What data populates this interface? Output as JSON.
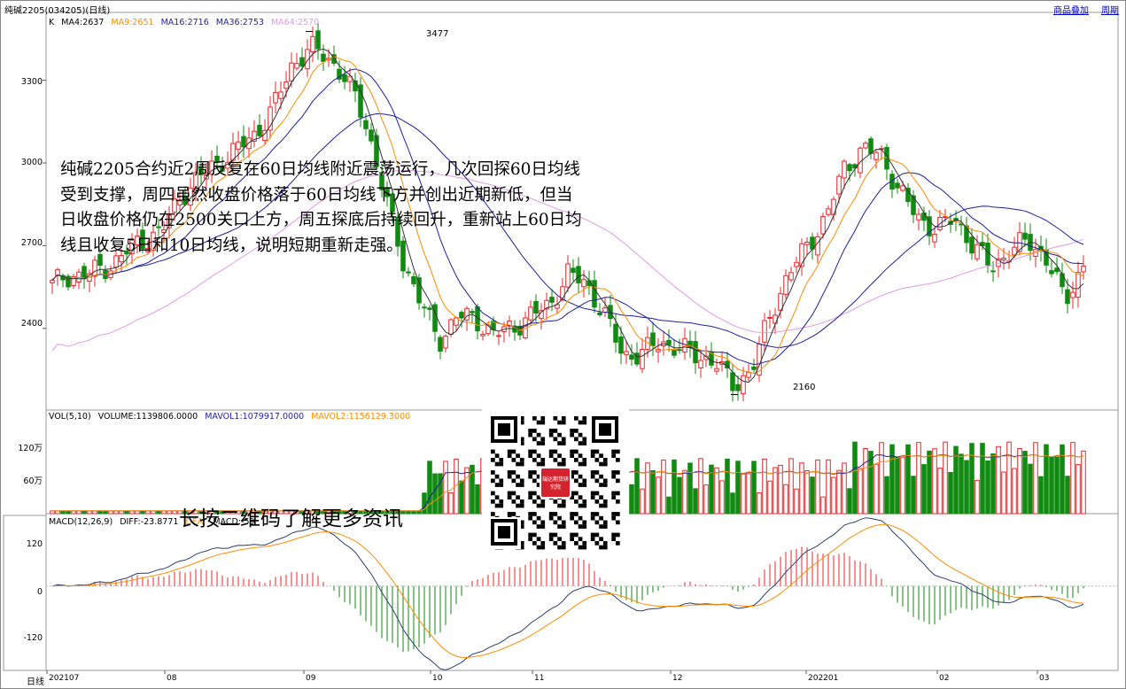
{
  "header": {
    "title": "纯碱2205(034205)(日线)",
    "link_overlay": "商品叠加",
    "link_period": "周期"
  },
  "colors": {
    "up": "#e8262b",
    "down": "#118a11",
    "ma4": "#333333",
    "ma9": "#ff8c00",
    "ma16": "#1f1f9f",
    "ma36": "#1f1f9f",
    "ma64": "#e29ae8",
    "diff": "#2b3f6e",
    "dea": "#ff8c00",
    "grid": "#b0b0b0"
  },
  "price_legend": {
    "k": "K",
    "ma4": "MA4:2637",
    "ma9": "MA9:2651",
    "ma16": "MA16:2716",
    "ma36": "MA36:2753",
    "ma64": "MA64:2570"
  },
  "volume_legend": {
    "vol": "VOL(5,10)",
    "volume": "VOLUME:1139806.0000",
    "mavol1": "MAVOL1:1079917.0000",
    "mavol2": "MAVOL2:1156129.3000"
  },
  "macd_legend": {
    "macd": "MACD(12,26,9)",
    "diff": "DIFF:-23.8771",
    "dea": "DEA:",
    "macd_val": "MACD:-59"
  },
  "bottom": {
    "period_label": "日线"
  },
  "annotation": {
    "text": "纯碱2205合约近2周反复在60日均线附近震荡运行，几次回探60日均线受到支撑，周四虽然收盘价格落于60日均线下方并创出近期新低，但当日收盘价格仍在2500关口上方，周五探底后持续回升，重新站上60日均线且收复5日和10日均线，说明短期重新走强。"
  },
  "qr": {
    "caption": "长按二维码了解更多资讯",
    "logo_text": "瑞达期货研究院"
  },
  "chart_data": {
    "type": "candlestick",
    "title": "纯碱2205(034205)(日线)",
    "x_ticks": [
      "202107",
      "08",
      "09",
      "10",
      "11",
      "12",
      "202201",
      "02",
      "03"
    ],
    "price_axis": {
      "ticks": [
        2400,
        2700,
        3000,
        3300
      ],
      "range": [
        2120,
        3530
      ]
    },
    "marked_high": {
      "label": "3477",
      "value": 3477
    },
    "marked_low": {
      "label": "2160",
      "value": 2160
    },
    "volume_axis": {
      "ticks": [
        "60万",
        "120万"
      ],
      "range": [
        0,
        1800000
      ]
    },
    "macd_axis": {
      "ticks": [
        -120,
        0,
        120
      ],
      "range": [
        -200,
        170
      ]
    },
    "key_prices": [
      2560,
      2590,
      2600,
      2620,
      2680,
      2720,
      2760,
      2880,
      2950,
      3000,
      3050,
      3100,
      3200,
      3350,
      3420,
      3380,
      3300,
      3150,
      2900,
      2650,
      2500,
      2350,
      2450,
      2430,
      2380,
      2400,
      2450,
      2480,
      2600,
      2560,
      2450,
      2300,
      2310,
      2350,
      2330,
      2300,
      2280,
      2190,
      2250,
      2450,
      2600,
      2700,
      2800,
      2980,
      3050,
      3030,
      2900,
      2800,
      2760,
      2800,
      2700,
      2620,
      2680,
      2720,
      2650,
      2500,
      2630
    ]
  }
}
